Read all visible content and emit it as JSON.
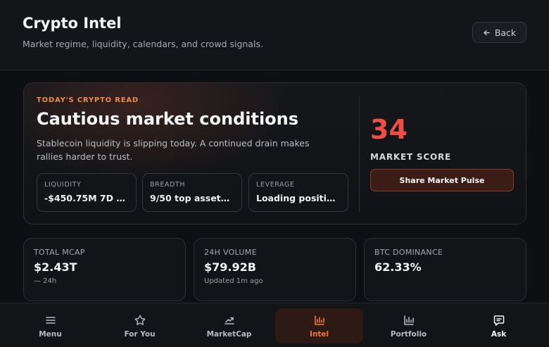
{
  "header": {
    "title": "Crypto Intel",
    "subtitle": "Market regime, liquidity, calendars, and crowd signals.",
    "back_label": "Back"
  },
  "hero": {
    "eyebrow": "TODAY'S CRYPTO READ",
    "headline": "Cautious market conditions",
    "description": "Stablecoin liquidity is slipping today. A continued drain makes rallies harder to trust.",
    "metrics": [
      {
        "label": "LIQUIDITY",
        "value": "-$450.75M 7D st..."
      },
      {
        "label": "BREADTH",
        "value": "9/50 top assets ..."
      },
      {
        "label": "LEVERAGE",
        "value": "Loading positioni..."
      }
    ],
    "score": "34",
    "score_label": "MARKET SCORE",
    "share_label": "Share Market Pulse"
  },
  "stats": [
    {
      "label": "TOTAL MCAP",
      "value": "$2.43T",
      "sub": "— 24h"
    },
    {
      "label": "24H VOLUME",
      "value": "$79.92B",
      "sub": "Updated 1m ago"
    },
    {
      "label": "BTC DOMINANCE",
      "value": "62.33%",
      "sub": ""
    }
  ],
  "nav": {
    "items": [
      {
        "label": "Menu",
        "icon": "menu-icon"
      },
      {
        "label": "For You",
        "icon": "star-icon"
      },
      {
        "label": "MarketCap",
        "icon": "trend-icon"
      },
      {
        "label": "Intel",
        "icon": "bar-chart-icon",
        "active": true
      },
      {
        "label": "Portfolio",
        "icon": "bar-chart-icon"
      },
      {
        "label": "Ask",
        "icon": "chat-icon"
      }
    ]
  },
  "colors": {
    "accent": "#f0783d",
    "score": "#ef4e44",
    "eyebrow": "#f08a4b"
  }
}
